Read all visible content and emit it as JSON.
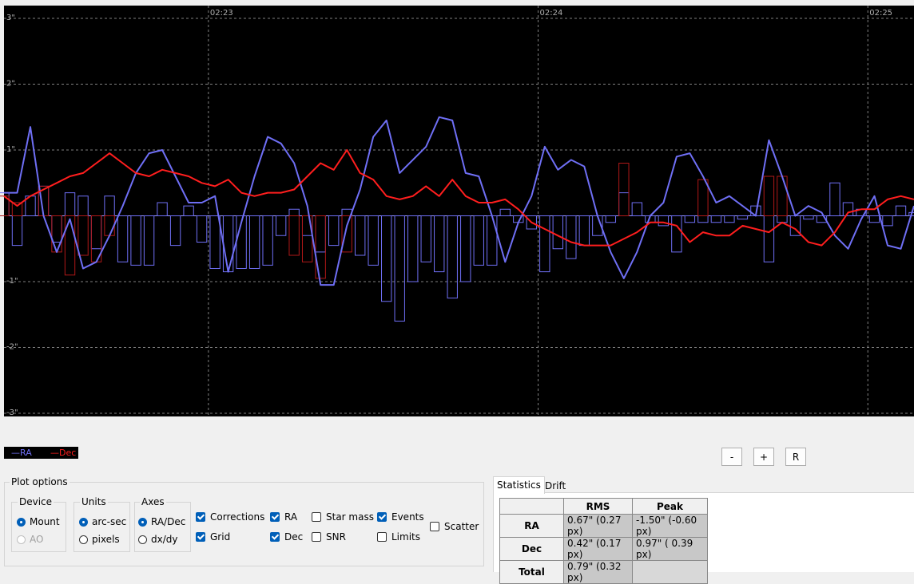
{
  "chart_data": {
    "type": "line",
    "title": "",
    "xlabel": "",
    "ylabel": "",
    "ylim": [
      -3,
      3
    ],
    "y_tick_labels": [
      "3\"",
      "2\"",
      "1\"",
      "-1\"",
      "-2\"",
      "-3\""
    ],
    "y_ticks": [
      3,
      2,
      1,
      -1,
      -2,
      -3
    ],
    "x_tick_labels": [
      "02:23",
      "02:24",
      "02:25"
    ],
    "x_ticks": [
      16.5,
      41.5,
      66.5
    ],
    "x_range": [
      1,
      70
    ],
    "grid": true,
    "background": "#000000",
    "series": [
      {
        "name": "RA",
        "kind": "line",
        "color": "#6f6ff5",
        "x": [
          1,
          2,
          3,
          4,
          5,
          6,
          7,
          8,
          9,
          10,
          11,
          12,
          13,
          14,
          15,
          16,
          17,
          18,
          19,
          20,
          21,
          22,
          23,
          24,
          25,
          26,
          27,
          28,
          29,
          30,
          31,
          32,
          33,
          34,
          35,
          36,
          37,
          38,
          39,
          40,
          41,
          42,
          43,
          44,
          45,
          46,
          47,
          48,
          49,
          50,
          51,
          52,
          53,
          54,
          55,
          56,
          57,
          58,
          59,
          60,
          61,
          62,
          63,
          64,
          65,
          66,
          67,
          68,
          69,
          70
        ],
        "values": [
          0.35,
          0.35,
          1.35,
          0.0,
          -0.55,
          -0.05,
          -0.8,
          -0.7,
          -0.3,
          0.15,
          0.65,
          0.95,
          1.0,
          0.6,
          0.2,
          0.2,
          0.3,
          -0.85,
          -0.1,
          0.6,
          1.2,
          1.1,
          0.8,
          0.15,
          -1.05,
          -1.05,
          -0.15,
          0.4,
          1.2,
          1.45,
          0.65,
          0.85,
          1.05,
          1.5,
          1.45,
          0.65,
          0.6,
          0.0,
          -0.7,
          -0.1,
          0.3,
          1.05,
          0.7,
          0.85,
          0.75,
          0.0,
          -0.55,
          -0.95,
          -0.55,
          0.0,
          0.2,
          0.9,
          0.95,
          0.6,
          0.2,
          0.3,
          0.15,
          0.0,
          1.15,
          0.6,
          0.0,
          0.15,
          0.05,
          -0.3,
          -0.5,
          -0.05,
          0.3,
          -0.45,
          -0.5,
          0.15
        ]
      },
      {
        "name": "Dec",
        "kind": "line",
        "color": "#ff1e1e",
        "x": [
          1,
          2,
          3,
          4,
          5,
          6,
          7,
          8,
          9,
          10,
          11,
          12,
          13,
          14,
          15,
          16,
          17,
          18,
          19,
          20,
          21,
          22,
          23,
          24,
          25,
          26,
          27,
          28,
          29,
          30,
          31,
          32,
          33,
          34,
          35,
          36,
          37,
          38,
          39,
          40,
          41,
          42,
          43,
          44,
          45,
          46,
          47,
          48,
          49,
          50,
          51,
          52,
          53,
          54,
          55,
          56,
          57,
          58,
          59,
          60,
          61,
          62,
          63,
          64,
          65,
          66,
          67,
          68,
          69,
          70
        ],
        "values": [
          0.3,
          0.15,
          0.3,
          0.4,
          0.5,
          0.6,
          0.65,
          0.8,
          0.95,
          0.8,
          0.65,
          0.6,
          0.7,
          0.65,
          0.6,
          0.5,
          0.45,
          0.55,
          0.35,
          0.3,
          0.35,
          0.35,
          0.4,
          0.6,
          0.8,
          0.7,
          1.0,
          0.65,
          0.55,
          0.3,
          0.25,
          0.3,
          0.45,
          0.3,
          0.55,
          0.3,
          0.2,
          0.2,
          0.25,
          0.1,
          -0.1,
          -0.2,
          -0.3,
          -0.4,
          -0.45,
          -0.45,
          -0.45,
          -0.35,
          -0.25,
          -0.1,
          -0.1,
          -0.15,
          -0.4,
          -0.25,
          -0.3,
          -0.3,
          -0.15,
          -0.2,
          -0.25,
          -0.1,
          -0.2,
          -0.4,
          -0.45,
          -0.25,
          0.05,
          0.1,
          0.1,
          0.25,
          0.3,
          0.25
        ]
      },
      {
        "name": "RA corrections",
        "kind": "bar",
        "color": "#6f6ff5",
        "x": [
          1,
          2,
          3,
          4,
          5,
          6,
          7,
          8,
          9,
          10,
          11,
          12,
          13,
          14,
          15,
          16,
          17,
          18,
          19,
          20,
          21,
          22,
          23,
          24,
          25,
          26,
          27,
          28,
          29,
          30,
          31,
          32,
          33,
          34,
          35,
          36,
          37,
          38,
          39,
          40,
          41,
          42,
          43,
          44,
          45,
          46,
          47,
          48,
          49,
          50,
          51,
          52,
          53,
          54,
          55,
          56,
          57,
          58,
          59,
          60,
          61,
          62,
          63,
          64,
          65,
          66,
          67,
          68,
          69,
          70
        ],
        "values": [
          0.35,
          -0.45,
          0.3,
          0.45,
          -0.4,
          0.35,
          0.3,
          -0.5,
          0.3,
          -0.7,
          -0.75,
          -0.75,
          0.2,
          -0.45,
          0.15,
          -0.4,
          -0.8,
          -0.85,
          -0.8,
          -0.8,
          -0.75,
          -0.3,
          0.1,
          -0.3,
          -0.55,
          -0.45,
          0.1,
          -0.6,
          -0.75,
          -1.3,
          -1.6,
          -1.0,
          -0.7,
          -0.85,
          -1.25,
          -1.0,
          -0.75,
          -0.75,
          0.1,
          -0.1,
          -0.2,
          -0.85,
          -0.5,
          -0.65,
          -0.45,
          -0.3,
          -0.1,
          0.35,
          0.2,
          -0.1,
          -0.15,
          -0.55,
          -0.1,
          -0.1,
          -0.1,
          -0.1,
          -0.05,
          0.15,
          -0.7,
          -0.1,
          -0.3,
          -0.05,
          -0.1,
          0.5,
          0.2,
          0.1,
          -0.1,
          -0.15,
          0.15,
          0.05
        ]
      },
      {
        "name": "Dec corrections",
        "kind": "bar",
        "color": "#b01818",
        "x": [
          1,
          2,
          3,
          4,
          5,
          6,
          7,
          8,
          9,
          10,
          11,
          12,
          13,
          14,
          15,
          16,
          17,
          18,
          19,
          20,
          21,
          22,
          23,
          24,
          25,
          26,
          27,
          28,
          29,
          30,
          31,
          32,
          33,
          34,
          35,
          36,
          37,
          38,
          39,
          40,
          41,
          42,
          43,
          44,
          45,
          46,
          47,
          48,
          49,
          50,
          51,
          52,
          53,
          54,
          55,
          56,
          57,
          58,
          59,
          60,
          61,
          62,
          63,
          64,
          65,
          66,
          67,
          68,
          69,
          70
        ],
        "values": [
          0.3,
          0.2,
          0.0,
          0.45,
          -0.55,
          -0.9,
          -0.6,
          -0.7,
          -0.3,
          0.0,
          0.0,
          0.0,
          0.0,
          0.0,
          0.0,
          0.0,
          0.0,
          0.0,
          0.0,
          0.0,
          0.0,
          0.0,
          -0.6,
          -0.7,
          -0.95,
          0.0,
          -0.55,
          0.0,
          0.0,
          0.0,
          0.0,
          0.0,
          0.0,
          0.0,
          0.0,
          0.0,
          0.0,
          0.0,
          0.0,
          0.0,
          0.0,
          0.0,
          0.0,
          0.0,
          0.0,
          0.0,
          0.0,
          0.8,
          0.0,
          0.0,
          0.0,
          0.0,
          0.0,
          0.55,
          0.0,
          0.0,
          0.0,
          0.0,
          0.6,
          0.6,
          0.0,
          0.0,
          0.0,
          0.0,
          0.0,
          0.0,
          0.0,
          0.0,
          0.0,
          0.0
        ]
      }
    ]
  },
  "legend": {
    "ra": "RA",
    "dec": "Dec"
  },
  "zoom": {
    "minus": "-",
    "plus": "+",
    "reset": "R"
  },
  "plot_options": {
    "title": "Plot options",
    "device": {
      "title": "Device",
      "mount": "Mount",
      "ao": "AO",
      "selected": "Mount"
    },
    "units": {
      "title": "Units",
      "arcsec": "arc-sec",
      "pixels": "pixels",
      "selected": "arc-sec"
    },
    "axes": {
      "title": "Axes",
      "radec": "RA/Dec",
      "dxdy": "dx/dy",
      "selected": "RA/Dec"
    },
    "checks": {
      "corrections": {
        "label": "Corrections",
        "checked": true
      },
      "grid": {
        "label": "Grid",
        "checked": true
      },
      "ra": {
        "label": "RA",
        "checked": true
      },
      "dec": {
        "label": "Dec",
        "checked": true
      },
      "star_mass": {
        "label": "Star mass",
        "checked": false
      },
      "snr": {
        "label": "SNR",
        "checked": false
      },
      "events": {
        "label": "Events",
        "checked": true
      },
      "limits": {
        "label": "Limits",
        "checked": false
      },
      "scatter": {
        "label": "Scatter",
        "checked": false
      }
    }
  },
  "tabs": {
    "statistics": "Statistics",
    "drift": "Drift",
    "active": "Statistics"
  },
  "stats": {
    "headers": {
      "rms": "RMS",
      "peak": "Peak"
    },
    "rows": [
      {
        "label": "RA",
        "rms": "0.67\" (0.27 px)",
        "peak": "-1.50\" (-0.60 px)"
      },
      {
        "label": "Dec",
        "rms": "0.42\" (0.17 px)",
        "peak": "0.97\" ( 0.39 px)"
      },
      {
        "label": "Total",
        "rms": "0.79\" (0.32 px)",
        "peak": ""
      }
    ]
  },
  "colors": {
    "ra": "#6f6ff5",
    "dec": "#ff1e1e",
    "grid": "#808080",
    "graph_bg": "#000000"
  }
}
